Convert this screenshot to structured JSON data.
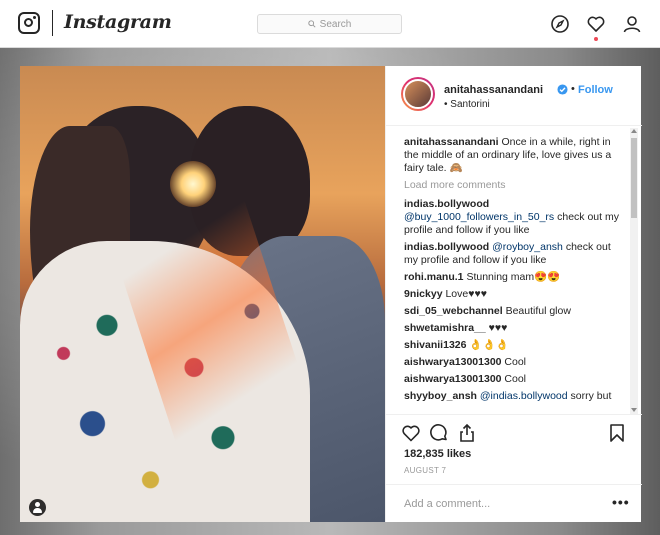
{
  "app": {
    "name": "Instagram"
  },
  "search": {
    "placeholder": "Search"
  },
  "post": {
    "username": "anitahassanandani",
    "follow_label": "Follow",
    "separator": "•",
    "location": "Santorini",
    "location_bullet": "•",
    "caption": {
      "user": "anitahassanandani",
      "text": "Once in a while, right in the middle of an ordinary life, love gives us a fairy tale. 🙈"
    },
    "load_more": "Load more comments",
    "comments": [
      {
        "user": "indias.bollywood",
        "mention": "@buy_1000_followers_in_50_rs",
        "text": "check out my profile and follow if you like"
      },
      {
        "user": "indias.bollywood",
        "mention": "@royboy_ansh",
        "text": "check out my profile and follow if you like"
      },
      {
        "user": "rohi.manu.1",
        "mention": "",
        "text": "Stunning mam😍😍"
      },
      {
        "user": "9nickyy",
        "mention": "",
        "text": "Love♥♥♥"
      },
      {
        "user": "sdi_05_webchannel",
        "mention": "",
        "text": "Beautiful glow"
      },
      {
        "user": "shwetamishra__",
        "mention": "",
        "text": "♥♥♥"
      },
      {
        "user": "shivanii1326",
        "mention": "",
        "text": "👌👌👌"
      },
      {
        "user": "aishwarya13001300",
        "mention": "",
        "text": "Cool"
      },
      {
        "user": "aishwarya13001300",
        "mention": "",
        "text": "Cool"
      },
      {
        "user": "shyyboy_ansh",
        "mention": "@indias.bollywood",
        "text": "sorry but"
      }
    ],
    "likes": "182,835 likes",
    "date": "AUGUST 7",
    "add_comment_placeholder": "Add a comment...",
    "more_options": "•••"
  },
  "colors": {
    "link": "#3897f0",
    "mention": "#003569",
    "muted": "#999999",
    "notify": "#ed4956"
  },
  "icons": [
    "camera-icon",
    "search-icon",
    "compass-icon",
    "heart-icon",
    "profile-icon",
    "verified-icon",
    "comment-icon",
    "share-icon",
    "bookmark-icon",
    "user-tag-icon"
  ]
}
